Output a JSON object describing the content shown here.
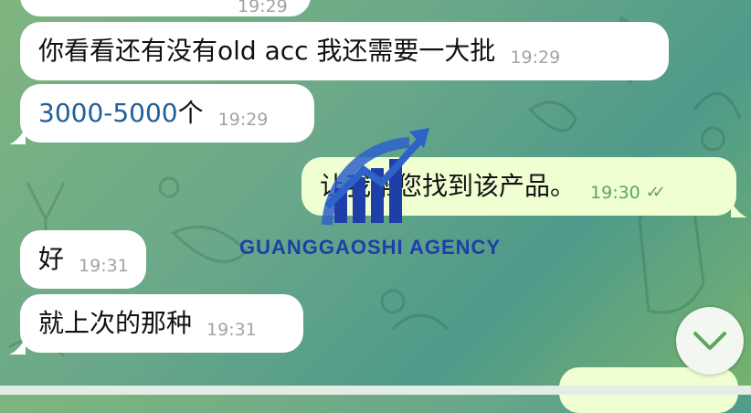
{
  "messages": [
    {
      "text": "你看看还有没有old acc 我还需要一大批",
      "time": "19:29",
      "dir": "in"
    },
    {
      "text": "3000-5000",
      "suffix": "个",
      "time": "19:29",
      "dir": "in"
    },
    {
      "text": "让我帮您找到该产品。",
      "time": "19:30",
      "dir": "out",
      "status": "read"
    },
    {
      "text": "好",
      "time": "19:31",
      "dir": "in"
    },
    {
      "text": "就上次的那种",
      "time": "19:31",
      "dir": "in"
    }
  ],
  "top_partial_time": "19:29",
  "watermark": {
    "name": "GUANGGAOSHI AGENCY"
  },
  "colors": {
    "incoming": "#ffffff",
    "outgoing": "#f0ffd2",
    "link": "#215e9b",
    "time_out": "#5fa558"
  },
  "icons": {
    "scroll_down": "chevron-down-icon",
    "read_ticks": "double-check-icon"
  }
}
